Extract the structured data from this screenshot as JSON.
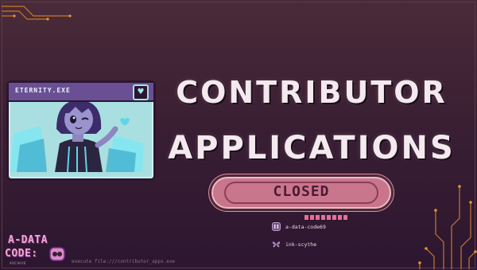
{
  "window": {
    "title": "ETERNITY.EXE",
    "heart_icon": "heart-icon"
  },
  "headline": {
    "line1": "CONTRIBUTOR",
    "line2": "APPLICATIONS"
  },
  "status": {
    "label": "CLOSED"
  },
  "credits": [
    {
      "icon": "data-code-logo-icon",
      "name": "a-data-code69"
    },
    {
      "icon": "butterfly-icon",
      "name": "ink-scythe"
    }
  ],
  "logo": {
    "line1": "A-DATA",
    "line2": "CODE:",
    "sub": "ARCHIVE"
  },
  "command": "execute file:///contributor_apps.exe",
  "colors": {
    "background": "#3a1f33",
    "accent_pink": "#e86f96",
    "pill": "#c9768d",
    "window_bg": "#a9dfe0",
    "window_bar": "#6a4f95",
    "circuit": "#d9862e"
  }
}
